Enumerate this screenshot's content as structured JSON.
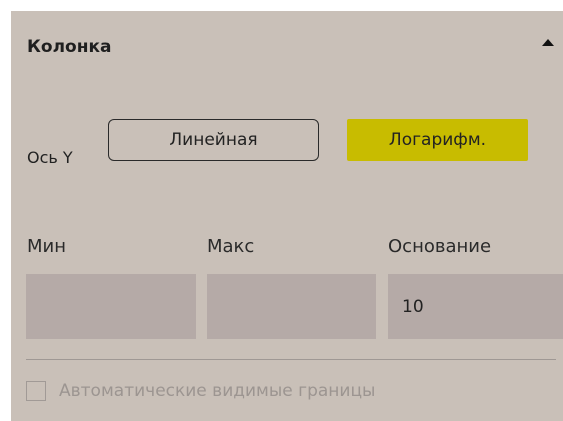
{
  "section": {
    "title": "Колонка",
    "collapse_icon": "caret-up-icon"
  },
  "axis": {
    "label": "Ось Y",
    "options": [
      {
        "label": "Линейная",
        "selected": false
      },
      {
        "label": "Логарифм.",
        "selected": true
      }
    ],
    "selected_color": "#c8bc00"
  },
  "fields": {
    "min_label": "Мин",
    "min_value": "",
    "max_label": "Макс",
    "max_value": "",
    "base_label": "Основание",
    "base_value": "10"
  },
  "auto_bounds": {
    "label": "Автоматические видимые границы",
    "checked": false,
    "disabled": true
  },
  "colors": {
    "panel_background": "#c9c0b8",
    "field_background": "#b5aaa7"
  }
}
